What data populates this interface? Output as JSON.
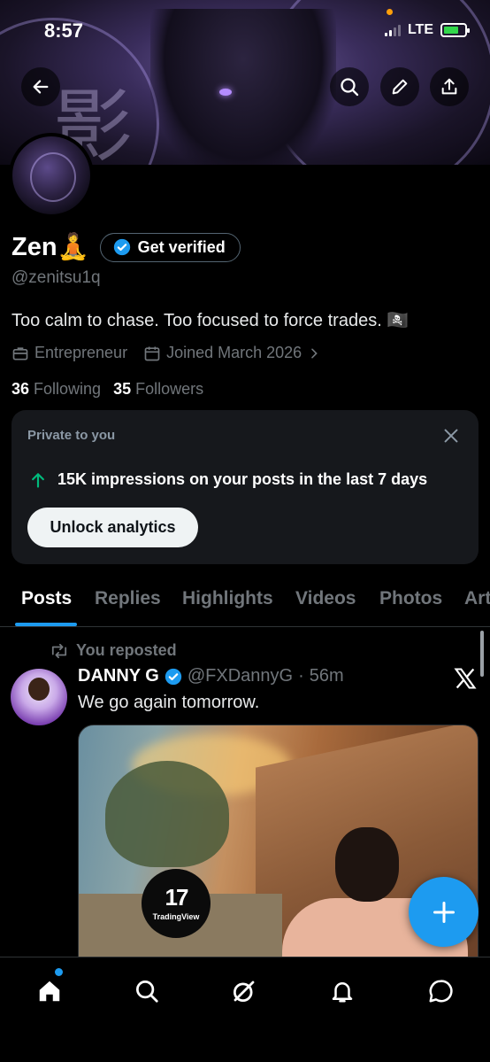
{
  "status_bar": {
    "time": "8:57",
    "network": "LTE"
  },
  "banner": {
    "kanji": "影"
  },
  "profile": {
    "name": "Zen🧘",
    "get_verified_label": "Get verified",
    "handle": "@zenitsu1q",
    "bio": "Too calm to chase. Too focused to force trades. 🏴‍☠️",
    "category": "Entrepreneur",
    "joined": "Joined March 2026",
    "following_count": "36",
    "following_label": "Following",
    "followers_count": "35",
    "followers_label": "Followers"
  },
  "private_card": {
    "title": "Private to you",
    "impressions_text": "15K impressions on your posts in the last 7 days",
    "unlock_label": "Unlock analytics"
  },
  "tabs": [
    {
      "label": "Posts",
      "active": true
    },
    {
      "label": "Replies",
      "active": false
    },
    {
      "label": "Highlights",
      "active": false
    },
    {
      "label": "Videos",
      "active": false
    },
    {
      "label": "Photos",
      "active": false
    },
    {
      "label": "Art",
      "active": false
    }
  ],
  "post": {
    "repost_label": "You reposted",
    "display_name": "DANNY G",
    "username": "@FXDannyG",
    "separator": "·",
    "time_ago": "56m",
    "text": "We go again tomorrow.",
    "media_badge": {
      "mark": "17",
      "label": "TradingView"
    }
  },
  "icons": {
    "back": "arrow-left-icon",
    "search": "search-icon",
    "edit": "pencil-icon",
    "share": "share-icon",
    "verified": "verified-badge-icon",
    "briefcase": "briefcase-icon",
    "calendar": "calendar-icon",
    "close": "close-icon",
    "arrow_up": "arrow-up-icon",
    "repost": "repost-icon",
    "x_logo": "x-logo-icon",
    "compose": "plus-icon",
    "nav": [
      "home-icon",
      "search-icon",
      "grok-icon",
      "bell-icon",
      "chat-icon"
    ]
  },
  "colors": {
    "accent": "#1d9bf0",
    "impressions_arrow": "#00ba7c",
    "background": "#000000",
    "card": "#16181c"
  }
}
